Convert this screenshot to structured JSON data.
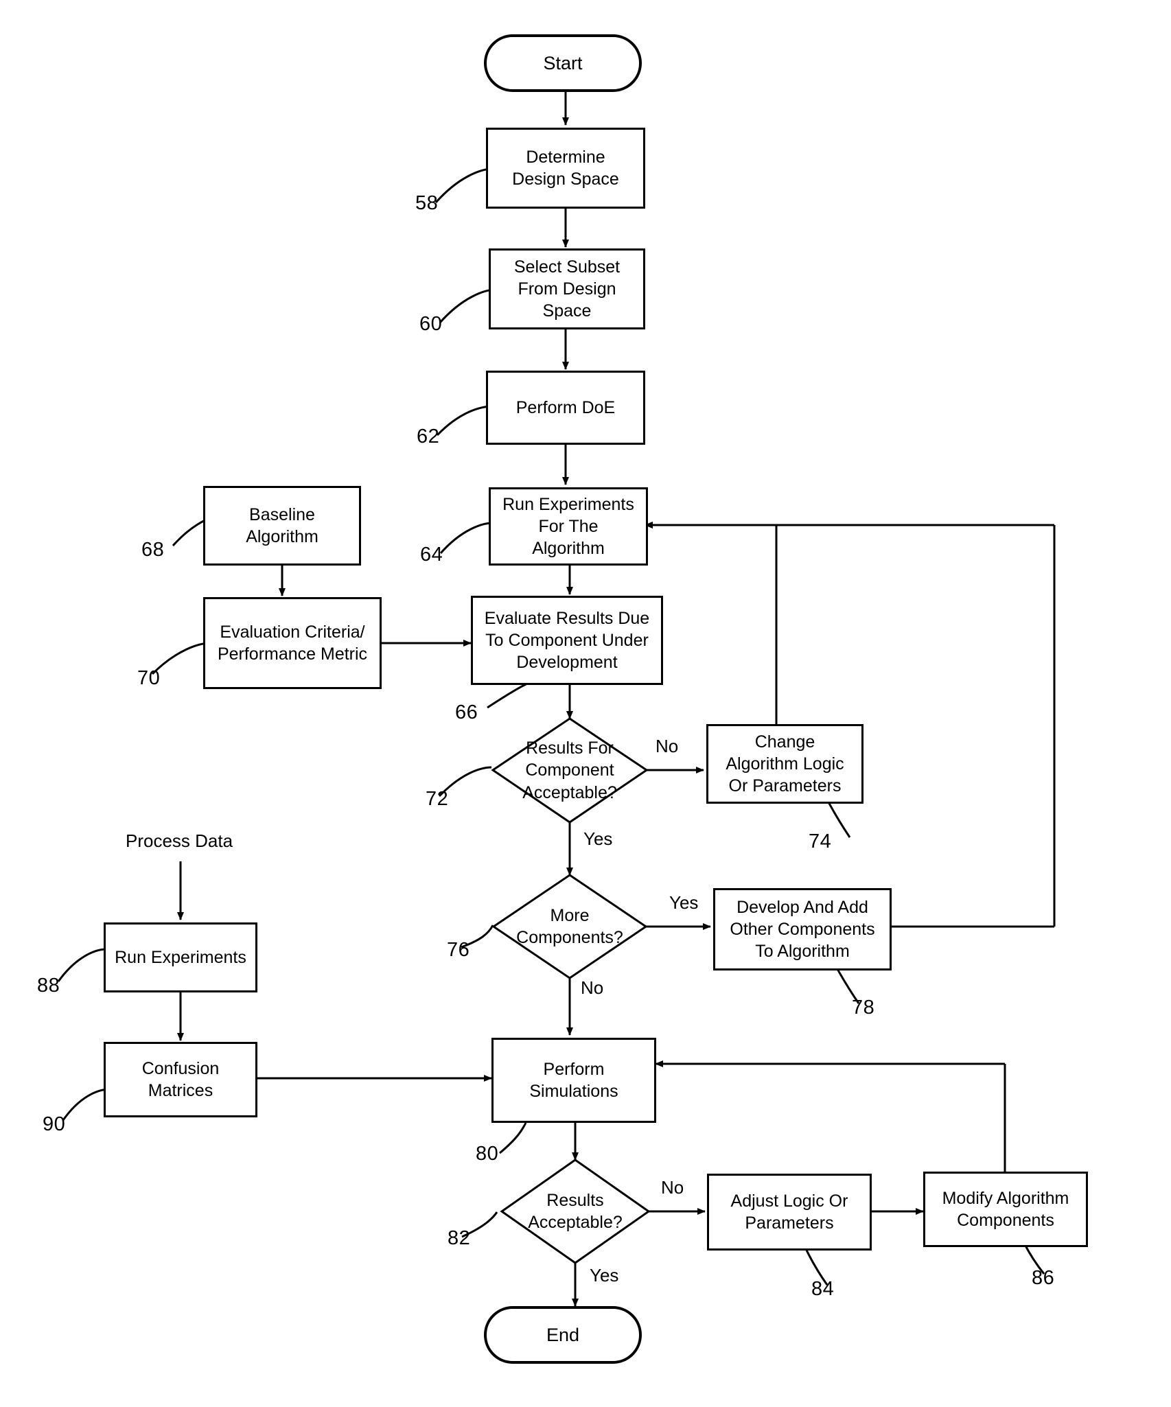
{
  "figure": {
    "type": "flowchart",
    "description": "Algorithm development process flowchart with numbered reference callouts"
  },
  "nodes": {
    "start": {
      "label": "Start",
      "shape": "terminal"
    },
    "determine_design_space": {
      "label": "Determine\nDesign Space",
      "shape": "process",
      "ref": "58"
    },
    "select_subset": {
      "label": "Select Subset\nFrom Design\nSpace",
      "shape": "process",
      "ref": "60"
    },
    "perform_doe": {
      "label": "Perform DoE",
      "shape": "process",
      "ref": "62"
    },
    "run_experiments_algorithm": {
      "label": "Run Experiments\nFor  The\nAlgorithm",
      "shape": "process",
      "ref": "64"
    },
    "baseline_algorithm": {
      "label": "Baseline\nAlgorithm",
      "shape": "process",
      "ref": "68"
    },
    "evaluation_criteria": {
      "label": "Evaluation Criteria/\nPerformance Metric",
      "shape": "process",
      "ref": "70"
    },
    "evaluate_results": {
      "label": "Evaluate Results Due\nTo Component Under\nDevelopment",
      "shape": "process",
      "ref": "66"
    },
    "results_for_component": {
      "label": "Results For\nComponent\nAcceptable?",
      "shape": "decision",
      "ref": "72"
    },
    "change_algorithm_logic": {
      "label": "Change\nAlgorithm Logic\nOr Parameters",
      "shape": "process",
      "ref": "74"
    },
    "more_components": {
      "label": "More\nComponents?",
      "shape": "decision",
      "ref": "76"
    },
    "develop_and_add": {
      "label": "Develop And Add\nOther Components\nTo Algorithm",
      "shape": "process",
      "ref": "78"
    },
    "process_data": {
      "label": "Process Data",
      "shape": "free-text"
    },
    "run_experiments": {
      "label": "Run Experiments",
      "shape": "process",
      "ref": "88"
    },
    "confusion_matrices": {
      "label": "Confusion\nMatrices",
      "shape": "process",
      "ref": "90"
    },
    "perform_simulations": {
      "label": "Perform\nSimulations",
      "shape": "process",
      "ref": "80"
    },
    "results_acceptable": {
      "label": "Results\nAcceptable?",
      "shape": "decision",
      "ref": "82"
    },
    "adjust_logic": {
      "label": "Adjust Logic Or\nParameters",
      "shape": "process",
      "ref": "84"
    },
    "modify_algorithm_components": {
      "label": "Modify Algorithm\nComponents",
      "shape": "process",
      "ref": "86"
    },
    "end": {
      "label": "End",
      "shape": "terminal"
    }
  },
  "edge_labels": {
    "component_no": "No",
    "component_yes": "Yes",
    "more_components_yes": "Yes",
    "more_components_no": "No",
    "results_no": "No",
    "results_yes": "Yes"
  },
  "reference_numbers": {
    "n58": "58",
    "n60": "60",
    "n62": "62",
    "n64": "64",
    "n66": "66",
    "n68": "68",
    "n70": "70",
    "n72": "72",
    "n74": "74",
    "n76": "76",
    "n78": "78",
    "n80": "80",
    "n82": "82",
    "n84": "84",
    "n86": "86",
    "n88": "88",
    "n90": "90"
  },
  "colors": {
    "stroke": "#000000",
    "fill": "#ffffff",
    "text": "#000000"
  }
}
